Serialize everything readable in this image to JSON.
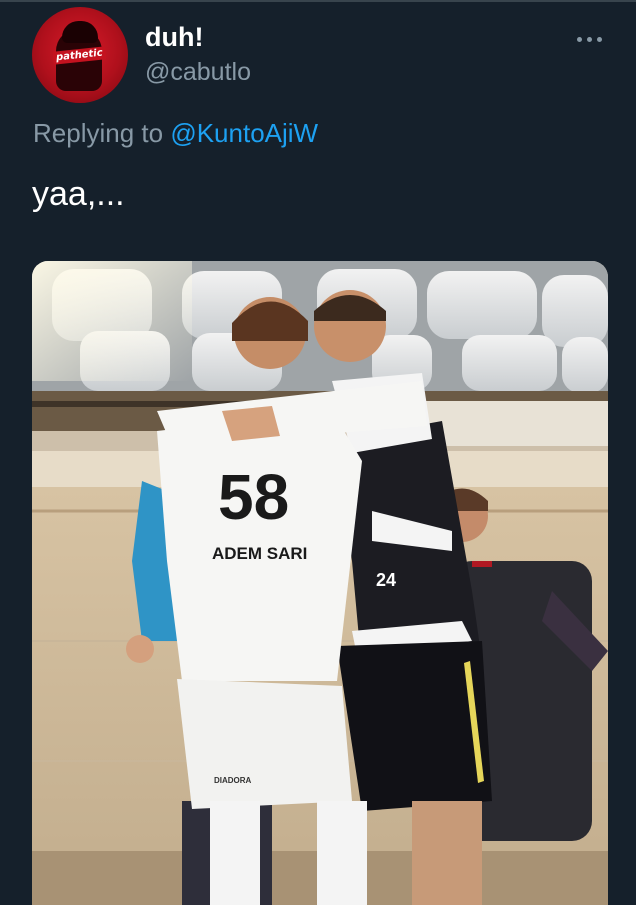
{
  "tweet": {
    "author": {
      "display_name": "duh!",
      "handle": "@cabutlo",
      "avatar_text": "pathetic"
    },
    "reply_context": {
      "prefix": "Replying to",
      "mention": "@KuntoAjiW"
    },
    "text": "yaa,...",
    "more_icon": "more-horizontal-icon"
  },
  "photo": {
    "jersey_number_front": "58",
    "jersey_name": "ADEM SARI",
    "jersey_number_back": "24",
    "shorts_brand": "DIADORA"
  },
  "colors": {
    "background": "#15202b",
    "secondary_text": "#8899a6",
    "link": "#1da1f2",
    "avatar_red": "#c4121f"
  }
}
